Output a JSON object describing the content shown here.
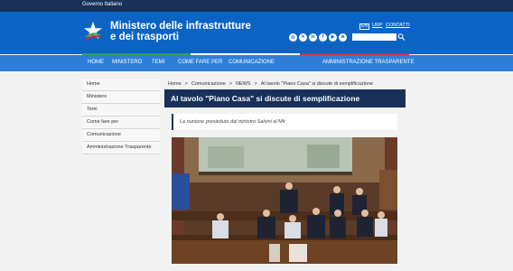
{
  "gov_bar": {
    "label": "Governo Italiano"
  },
  "header": {
    "title": "Ministero delle infrastrutture e dei trasporti",
    "lang": "EN",
    "links": [
      "URP",
      "CONTATTI"
    ],
    "social": [
      "instagram-icon",
      "x-icon",
      "linkedin-icon",
      "facebook-icon",
      "youtube-icon",
      "rss-icon"
    ],
    "search_placeholder": ""
  },
  "nav": [
    "HOME",
    "MINISTERO",
    "TEMI",
    "COME FARE PER",
    "COMUNICAZIONE",
    "AMMINISTRAZIONE TRASPARENTE"
  ],
  "sidebar": [
    "Home",
    "Ministero",
    "Temi",
    "Come fare per",
    "Comunicazione",
    "Amministrazione Trasparente"
  ],
  "breadcrumb": [
    "Home",
    "Comunicazione",
    "NEWS",
    "Al tavolo \"Piano Casa\" si discute di semplificazione"
  ],
  "article": {
    "title": "Al tavolo \"Piano Casa\" si discute di semplificazione",
    "subtitle": "La riunione presieduta dal ministro Salvini al Mit"
  },
  "colors": {
    "gov_bar": "#18305a",
    "header": "#0b64c4",
    "nav": "#2f7fd8",
    "green": "#2f9e4f",
    "red": "#c8323c"
  }
}
